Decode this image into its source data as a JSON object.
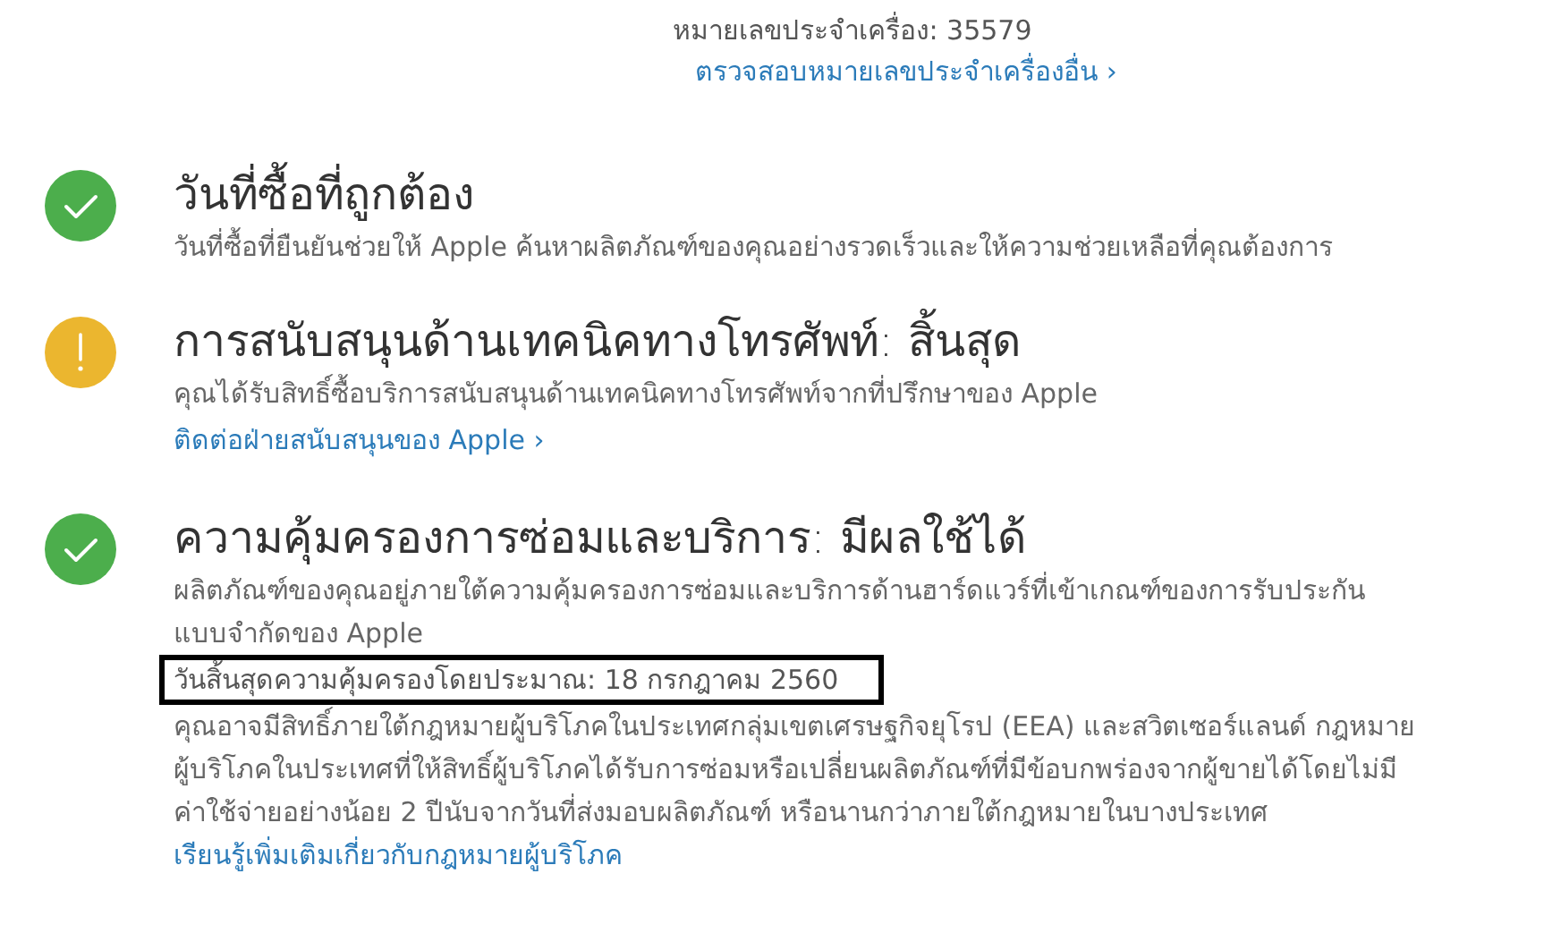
{
  "serial": {
    "label": "หมายเลขประจำเครื่อง: 35579",
    "link": "ตรวจสอบหมายเลขประจำเครื่องอื่น ›"
  },
  "sections": [
    {
      "kind": "ok",
      "title": "วันที่ซื้อที่ถูกต้อง",
      "description": "วันที่ซื้อที่ยืนยันช่วยให้ Apple ค้นหาผลิตภัณฑ์ของคุณอย่างรวดเร็วและให้ความช่วยเหลือที่คุณต้องการ"
    },
    {
      "kind": "warning",
      "title": "การสนับสนุนด้านเทคนิคทางโทรศัพท์: สิ้นสุด",
      "description": "คุณได้รับสิทธิ์ซื้อบริการสนับสนุนด้านเทคนิคทางโทรศัพท์จากที่ปรึกษาของ Apple",
      "link": "ติดต่อฝ่ายสนับสนุนของ Apple ›"
    },
    {
      "kind": "ok",
      "title": "ความคุ้มครองการซ่อมและบริการ: มีผลใช้ได้",
      "description": "ผลิตภัณฑ์ของคุณอยู่ภายใต้ความคุ้มครองการซ่อมและบริการด้านฮาร์ดแวร์ที่เข้าเกณฑ์ของการรับประกันแบบจำกัดของ Apple",
      "note": {
        "text": "วันสิ้นสุดความคุ้มครองโดยประมาณ: 18 กรกฎาคม 2560",
        "highlighted": true
      },
      "legal": {
        "text": "คุณอาจมีสิทธิ์ภายใต้กฎหมายผู้บริโภคในประเทศกลุ่มเขตเศรษฐกิจยุโรป (EEA) และสวิตเซอร์แลนด์ กฎหมายผู้บริโภคในประเทศที่ให้สิทธิ์ผู้บริโภคได้รับการซ่อมหรือเปลี่ยนผลิตภัณฑ์ที่มีข้อบกพร่องจากผู้ขายได้โดยไม่มีค่าใช้จ่ายอย่างน้อย 2 ปีนับจากวันที่ส่งมอบผลิตภัณฑ์ หรือนานกว่าภายใต้กฎหมายในบางประเทศ",
        "link": "เรียนรู้เพิ่มเติมเกี่ยวกับกฎหมายผู้บริโภค"
      }
    }
  ]
}
